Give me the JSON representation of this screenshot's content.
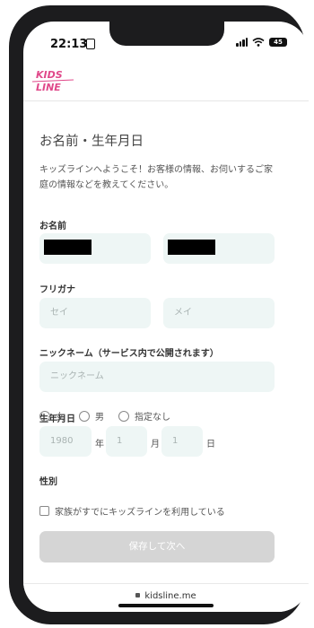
{
  "status_bar": {
    "time": "22:13",
    "battery": "45"
  },
  "header": {
    "logo_text_top": "KIDS",
    "logo_text_bottom": "LINE"
  },
  "form": {
    "title": "お名前・生年月日",
    "intro": "キッズラインへようこそ！お客様の情報、お伺いするご家庭の情報などを教えてください。",
    "name_label": "お名前",
    "furigana_label": "フリガナ",
    "furigana_sei_placeholder": "セイ",
    "furigana_mei_placeholder": "メイ",
    "nickname_label": "ニックネーム（サービス内で公開されます）",
    "nickname_placeholder": "ニックネーム",
    "birthday_label": "生年月日",
    "birth_year": "1980",
    "year_unit": "年",
    "birth_month": "1",
    "month_unit": "月",
    "birth_day": "1",
    "day_unit": "日",
    "gender_label": "性別",
    "gender_options": [
      "女",
      "男",
      "指定なし"
    ],
    "family_checkbox_label": "家族がすでにキッズラインを利用している",
    "submit_label": "保存して次へ"
  },
  "browser": {
    "url": "kidsline.me"
  },
  "colors": {
    "field_bg": "#eef6f5",
    "logo_pink": "#e0498a",
    "disabled_button": "#d5d5d5"
  }
}
